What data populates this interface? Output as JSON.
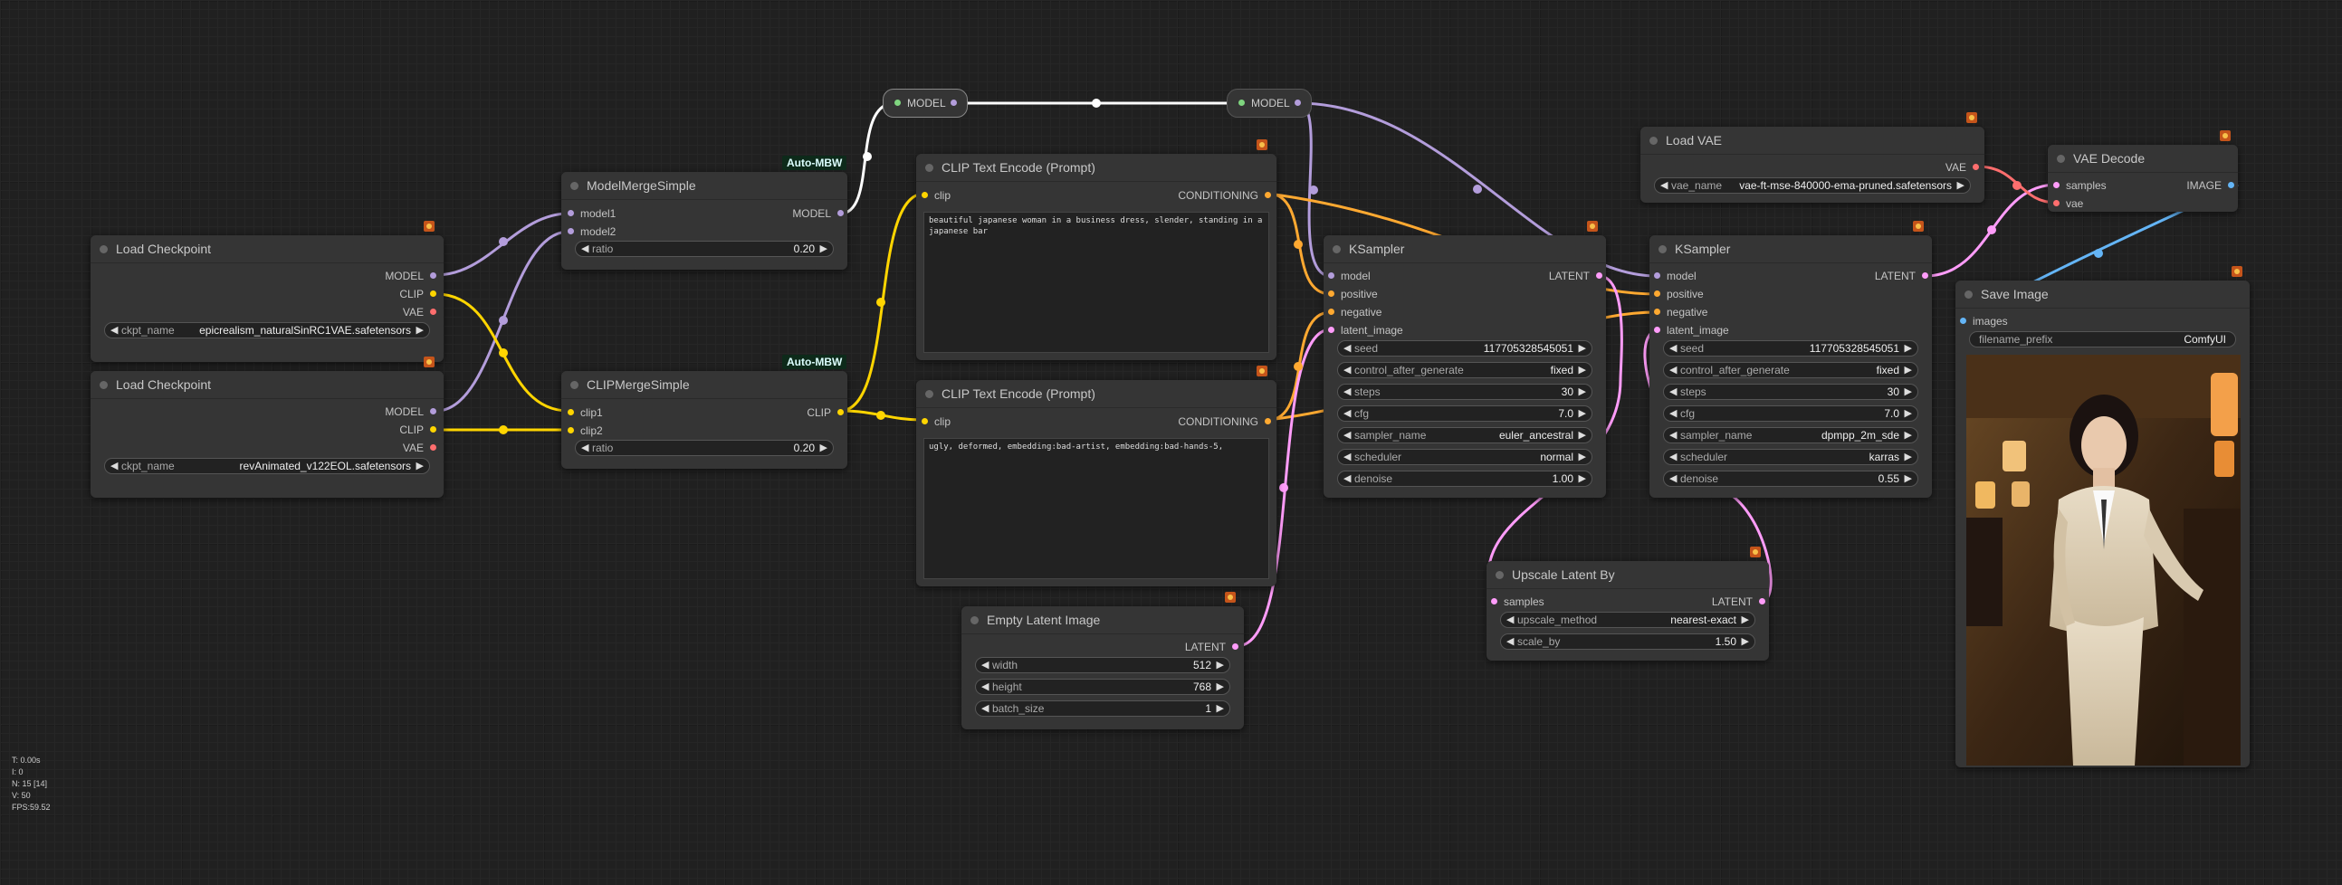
{
  "colors": {
    "model": "#b39ddb",
    "clip": "#ffd500",
    "vae": "#ff6e6e",
    "conditioning": "#ffa931",
    "latent": "#ff9cf9",
    "image": "#64b5f6",
    "link_white": "#ffffff",
    "group_green": "#0d2a1a"
  },
  "reroutes": {
    "model_a": "MODEL",
    "model_b": "MODEL"
  },
  "groups": {
    "auto_a": "Auto-MBW",
    "auto_b": "Auto-MBW"
  },
  "ckpt1": {
    "title": "Load Checkpoint",
    "out_model": "MODEL",
    "out_clip": "CLIP",
    "out_vae": "VAE",
    "w_label": "ckpt_name",
    "w_value": "epicrealism_naturalSinRC1VAE.safetensors"
  },
  "ckpt2": {
    "title": "Load Checkpoint",
    "out_model": "MODEL",
    "out_clip": "CLIP",
    "out_vae": "VAE",
    "w_label": "ckpt_name",
    "w_value": "revAnimated_v122EOL.safetensors"
  },
  "mms": {
    "title": "ModelMergeSimple",
    "in1": "model1",
    "in2": "model2",
    "out": "MODEL",
    "w_label": "ratio",
    "w_value": "0.20"
  },
  "cms": {
    "title": "CLIPMergeSimple",
    "in1": "clip1",
    "in2": "clip2",
    "out": "CLIP",
    "w_label": "ratio",
    "w_value": "0.20"
  },
  "cte1": {
    "title": "CLIP Text Encode (Prompt)",
    "in": "clip",
    "out": "CONDITIONING",
    "text": "beautiful japanese woman in a business dress, slender, standing in a japanese bar"
  },
  "cte2": {
    "title": "CLIP Text Encode (Prompt)",
    "in": "clip",
    "out": "CONDITIONING",
    "text": "ugly, deformed, embedding:bad-artist, embedding:bad-hands-5,"
  },
  "ela": {
    "title": "Empty Latent Image",
    "out": "LATENT",
    "widgets": [
      {
        "label": "width",
        "value": "512"
      },
      {
        "label": "height",
        "value": "768"
      },
      {
        "label": "batch_size",
        "value": "1"
      }
    ]
  },
  "ks1": {
    "title": "KSampler",
    "inputs": [
      "model",
      "positive",
      "negative",
      "latent_image"
    ],
    "out": "LATENT",
    "widgets": [
      {
        "label": "seed",
        "value": "117705328545051"
      },
      {
        "label": "control_after_generate",
        "value": "fixed"
      },
      {
        "label": "steps",
        "value": "30"
      },
      {
        "label": "cfg",
        "value": "7.0"
      },
      {
        "label": "sampler_name",
        "value": "euler_ancestral"
      },
      {
        "label": "scheduler",
        "value": "normal"
      },
      {
        "label": "denoise",
        "value": "1.00"
      }
    ]
  },
  "ks2": {
    "title": "KSampler",
    "inputs": [
      "model",
      "positive",
      "negative",
      "latent_image"
    ],
    "out": "LATENT",
    "widgets": [
      {
        "label": "seed",
        "value": "117705328545051"
      },
      {
        "label": "control_after_generate",
        "value": "fixed"
      },
      {
        "label": "steps",
        "value": "30"
      },
      {
        "label": "cfg",
        "value": "7.0"
      },
      {
        "label": "sampler_name",
        "value": "dpmpp_2m_sde"
      },
      {
        "label": "scheduler",
        "value": "karras"
      },
      {
        "label": "denoise",
        "value": "0.55"
      }
    ]
  },
  "upscale": {
    "title": "Upscale Latent By",
    "in": "samples",
    "out": "LATENT",
    "widgets": [
      {
        "label": "upscale_method",
        "value": "nearest-exact"
      },
      {
        "label": "scale_by",
        "value": "1.50"
      }
    ]
  },
  "loadvae": {
    "title": "Load VAE",
    "out": "VAE",
    "w_label": "vae_name",
    "w_value": "vae-ft-mse-840000-ema-pruned.safetensors"
  },
  "vaedecode": {
    "title": "VAE Decode",
    "in1": "samples",
    "in2": "vae",
    "out": "IMAGE"
  },
  "save": {
    "title": "Save Image",
    "in": "images",
    "w_label": "filename_prefix",
    "w_value": "ComfyUI"
  },
  "stats": [
    "T: 0.00s",
    "I: 0",
    "N: 15 [14]",
    "V: 50",
    "FPS:59.52"
  ]
}
